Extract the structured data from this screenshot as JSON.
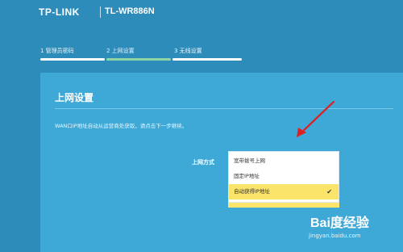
{
  "header": {
    "brand": "TP-LINK",
    "model": "TL-WR886N"
  },
  "steps": [
    {
      "label": "1 管理员密码",
      "color": "#ffffff"
    },
    {
      "label": "2 上网设置",
      "color": "#8fd5a6"
    },
    {
      "label": "3 无线设置",
      "color": "#ffffff"
    }
  ],
  "panel": {
    "title": "上网设置",
    "description": "WAN口IP地址自动从运营商处获取，请点击下一步继续。",
    "field_label": "上网方式"
  },
  "dropdown": {
    "options": [
      {
        "label": "宽带拨号上网",
        "selected": false
      },
      {
        "label": "固定IP地址",
        "selected": false
      },
      {
        "label": "自动获得IP地址",
        "selected": true
      }
    ],
    "selected_icon": "check-icon"
  },
  "watermark": {
    "logo": "Bai度经验",
    "url": "jingyan.baidu.com"
  },
  "colors": {
    "background": "#2e8cba",
    "panel": "#3ea8d6",
    "highlight": "#fbe46a",
    "annotation_arrow": "#e02020"
  }
}
